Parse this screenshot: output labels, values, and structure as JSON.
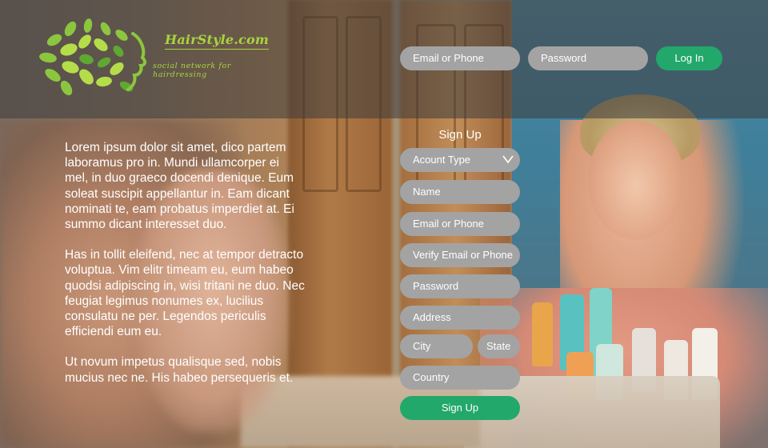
{
  "header": {
    "logo": {
      "brand": "HairStyle.com",
      "tagline": "social network for hairdressing"
    },
    "login": {
      "email_placeholder": "Email or Phone",
      "password_placeholder": "Password",
      "login_label": "Log In"
    }
  },
  "intro": {
    "paragraphs": [
      "Lorem ipsum dolor sit amet, dico partem laboramus pro in. Mundi ullamcorper ei mel, in duo graeco docendi denique. Eum soleat suscipit appellantur in. Eam dicant nominati te, eam probatus imperdiet at. Ei summo dicant interesset duo.",
      "Has in tollit eleifend, nec at tempor detracto voluptua. Vim elitr timeam eu, eum habeo quodsi adipiscing in, wisi tritani ne duo. Nec feugiat legimus nonumes ex, lucilius consulatu ne per. Legendos periculis efficiendi eum eu.",
      "Ut novum impetus qualisque sed, nobis mucius nec ne. His habeo persequeris et."
    ]
  },
  "signup": {
    "title": "Sign Up",
    "account_type": "Acount Type",
    "name": "Name",
    "email": "Email or Phone",
    "verify_email": "Verify Email or Phone",
    "password": "Password",
    "address": "Address",
    "city": "City",
    "state": "State",
    "country": "Country",
    "submit_label": "Sign Up"
  },
  "colors": {
    "accent_green": "#22a86a",
    "logo_green": "#a9d43e",
    "field_gray": "#a3a3a3"
  },
  "icons": {
    "select": "chevron-down-icon",
    "logo": "leaf-swirl-logo-icon"
  }
}
